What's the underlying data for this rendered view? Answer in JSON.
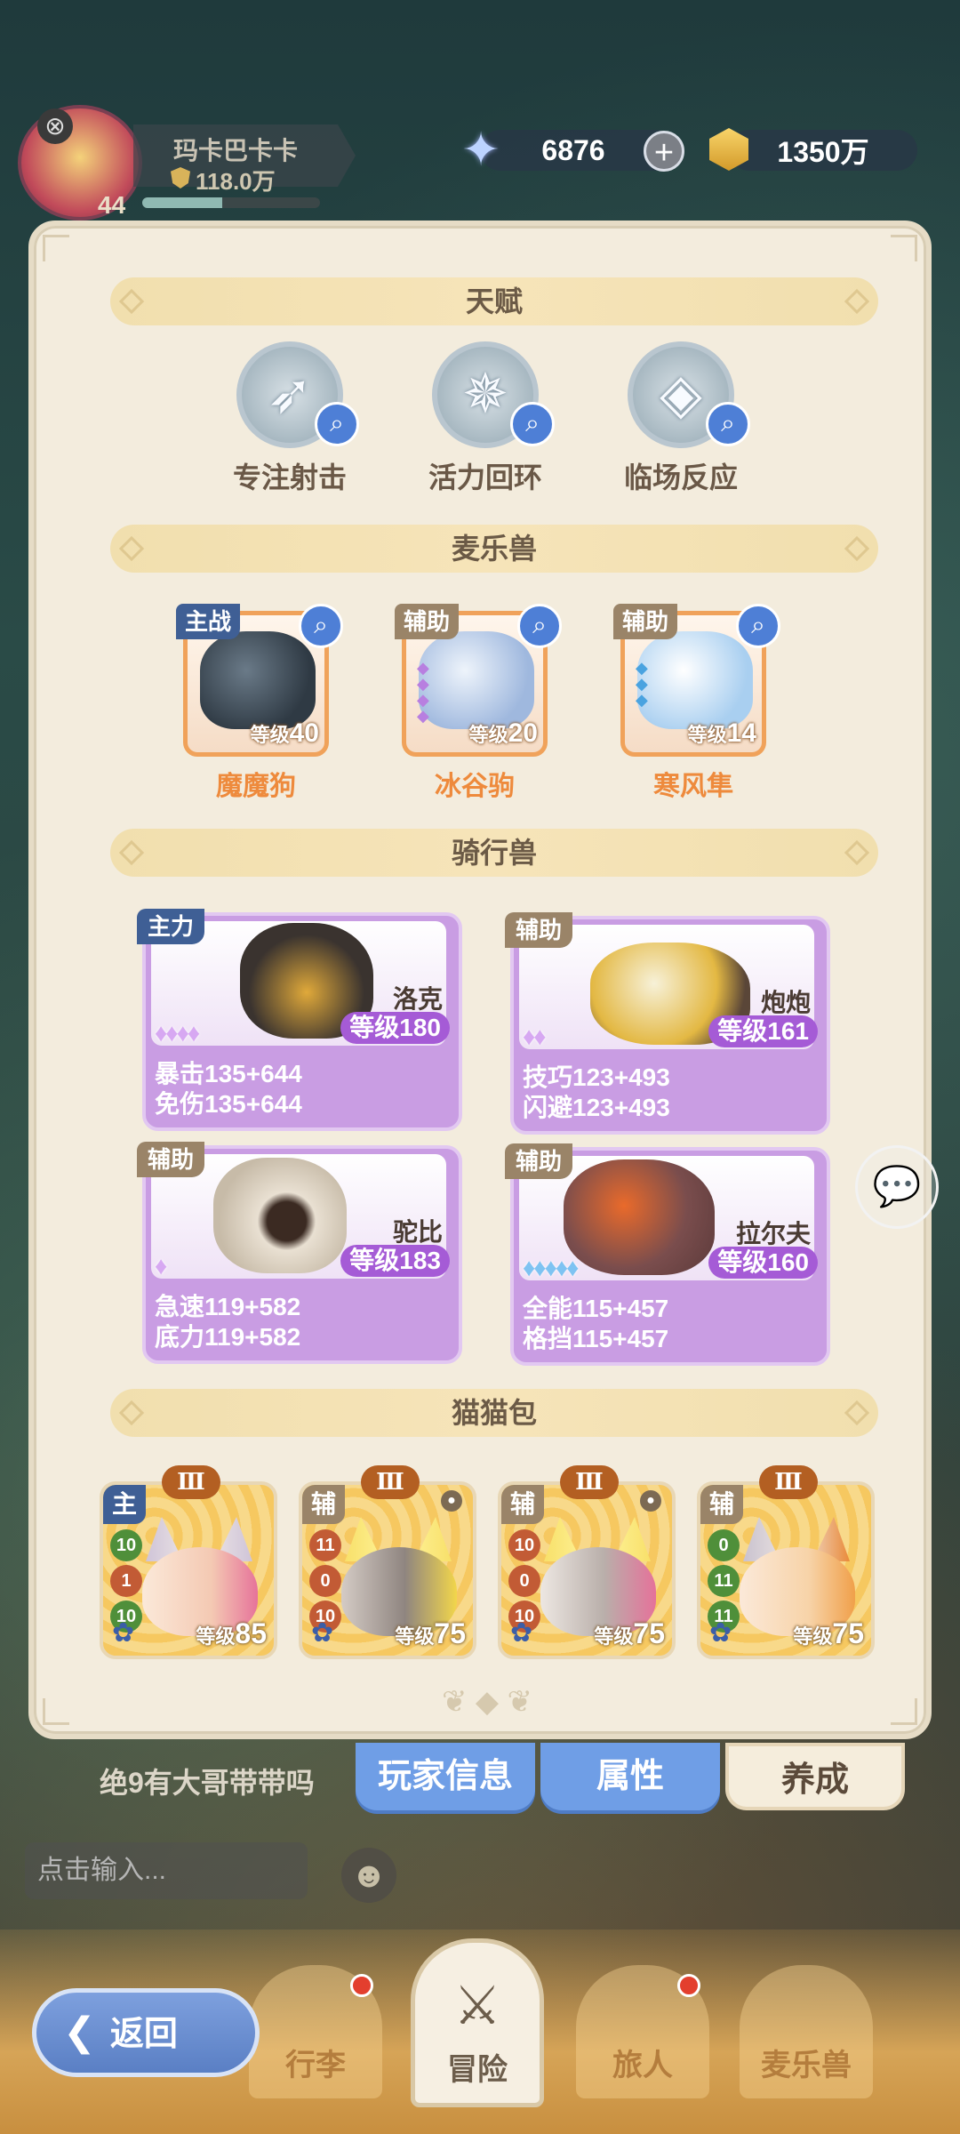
{
  "player": {
    "name": "玛卡巴卡卡",
    "power": "118.0万",
    "level": "44",
    "exp_fraction": 0.45
  },
  "currency": {
    "gems": "6876",
    "gold": "1350万"
  },
  "sections": {
    "talent": "天赋",
    "beasts": "麦乐兽",
    "mounts": "骑行兽",
    "cats": "猫猫包"
  },
  "talents": [
    {
      "label": "专注射击",
      "icon": "bow-icon"
    },
    {
      "label": "活力回环",
      "icon": "star-burst-icon"
    },
    {
      "label": "临场反应",
      "icon": "crystal-icon"
    }
  ],
  "beasts": [
    {
      "tag": "主战",
      "name": "魔魔狗",
      "level_label": "等级",
      "level": "40",
      "color": "#2f3a44"
    },
    {
      "tag": "辅助",
      "name": "冰谷驹",
      "level_label": "等级",
      "level": "20",
      "color": "#b8cde9"
    },
    {
      "tag": "辅助",
      "name": "寒风隼",
      "level_label": "等级",
      "level": "14",
      "color": "#d9e8f8"
    }
  ],
  "mounts": [
    {
      "tag": "主力",
      "name": "洛克",
      "level_label": "等级",
      "level": "180",
      "stars": "♦♦♦♦",
      "stat1": "暴击135+644",
      "stat2": "免伤135+644"
    },
    {
      "tag": "辅助",
      "name": "炮炮",
      "level_label": "等级",
      "level": "161",
      "stars": "♦♦",
      "stat1": "技巧123+493",
      "stat2": "闪避123+493"
    },
    {
      "tag": "辅助",
      "name": "驼比",
      "level_label": "等级",
      "level": "183",
      "stars": "♦",
      "stat1": "急速119+582",
      "stat2": "底力119+582"
    },
    {
      "tag": "辅助",
      "name": "拉尔夫",
      "level_label": "等级",
      "level": "160",
      "stars": "♦♦♦♦♦",
      "stat1": "全能115+457",
      "stat2": "格挡115+457"
    }
  ],
  "cats": [
    {
      "tag": "主",
      "rank": "Ⅲ",
      "nums": [
        "10",
        "1",
        "10"
      ],
      "level_label": "等级",
      "level": "85"
    },
    {
      "tag": "辅",
      "rank": "Ⅲ",
      "nums": [
        "11",
        "0",
        "10"
      ],
      "level_label": "等级",
      "level": "75"
    },
    {
      "tag": "辅",
      "rank": "Ⅲ",
      "nums": [
        "10",
        "0",
        "10"
      ],
      "level_label": "等级",
      "level": "75"
    },
    {
      "tag": "辅",
      "rank": "Ⅲ",
      "nums": [
        "0",
        "11",
        "11"
      ],
      "level_label": "等级",
      "level": "75"
    }
  ],
  "tabs": [
    "玩家信息",
    "属性",
    "养成"
  ],
  "chat": {
    "last_message": "绝9有大哥带带吗",
    "input_placeholder": "点击输入..."
  },
  "nav": [
    "行李",
    "冒险",
    "旅人",
    "麦乐兽"
  ],
  "back_label": "返回"
}
